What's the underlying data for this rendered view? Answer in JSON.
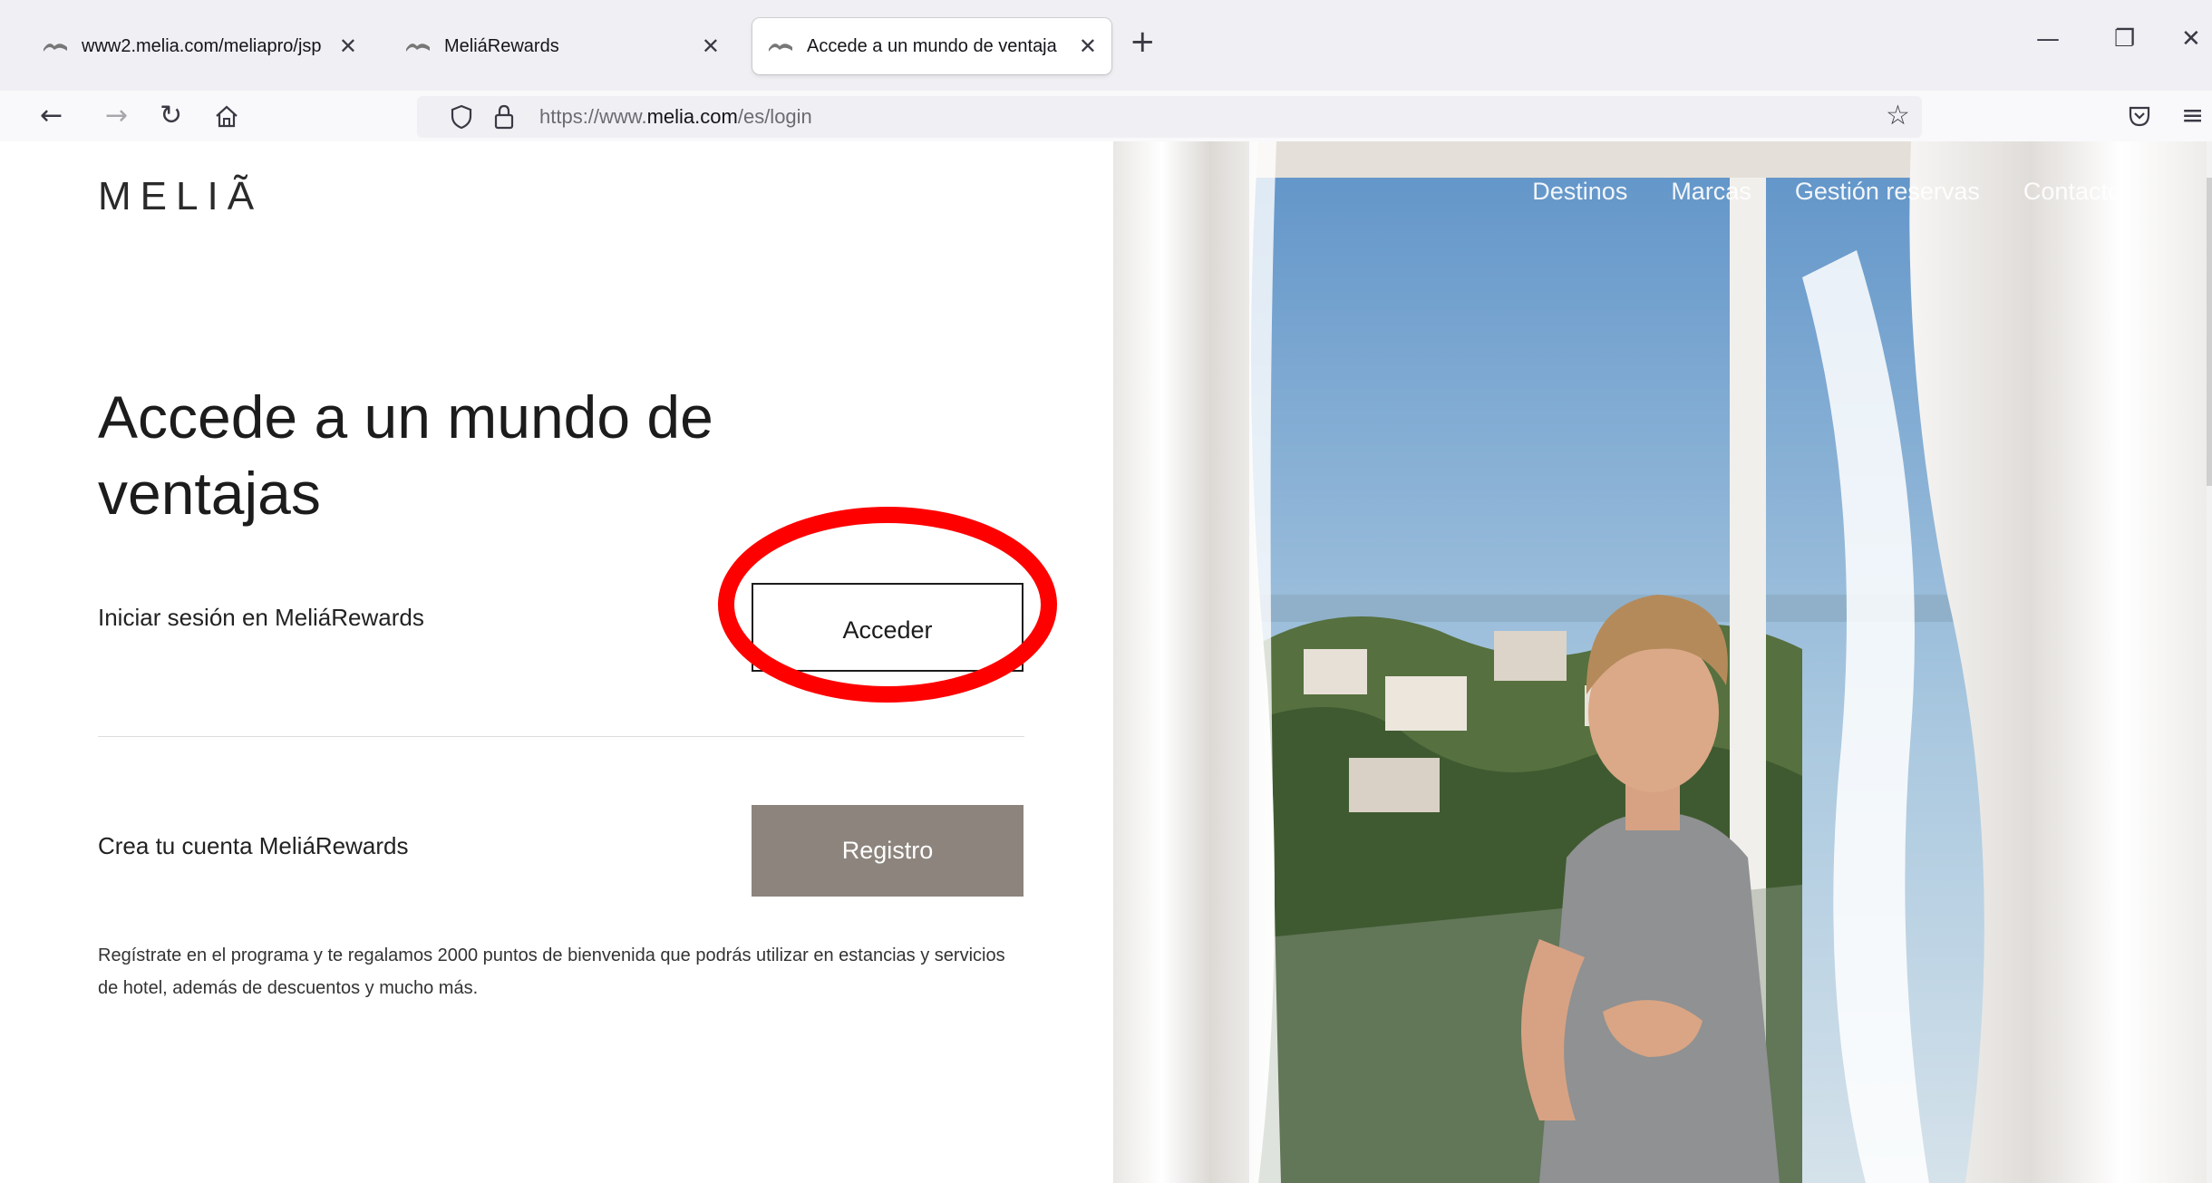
{
  "browser": {
    "tabs": [
      {
        "title": "www2.melia.com/meliapro/jsp",
        "active": false
      },
      {
        "title": "MeliáRewards",
        "active": false
      },
      {
        "title": "Accede a un mundo de ventaja",
        "active": true
      }
    ],
    "url": {
      "scheme": "https://www.",
      "host": "melia.com",
      "path": "/es/login"
    },
    "icons": {
      "back": "back-arrow-icon",
      "forward": "forward-arrow-icon",
      "reload": "reload-icon",
      "home": "home-icon",
      "shield": "shield-icon",
      "lock": "lock-icon",
      "star": "bookmark-star-icon",
      "pocket": "pocket-icon",
      "menu": "hamburger-menu-icon"
    }
  },
  "site": {
    "logo": "MELIÃ",
    "nav": [
      "Destinos",
      "Marcas",
      "Gestión reservas",
      "Contacto"
    ]
  },
  "login": {
    "heading": "Accede a un mundo de ventajas",
    "signin_label": "Iniciar sesión en MeliáRewards",
    "signin_button": "Acceder",
    "register_label": "Crea tu cuenta MeliáRewards",
    "register_button": "Registro",
    "promo": "Regístrate en el programa y te regalamos 2000 puntos de bienvenida que podrás utilizar en estancias y servicios de hotel, además de descuentos y mucho más."
  },
  "colors": {
    "register_button_bg": "#8c847d",
    "highlight_ring": "#ff0000",
    "browser_chrome": "#f0f0f4"
  }
}
